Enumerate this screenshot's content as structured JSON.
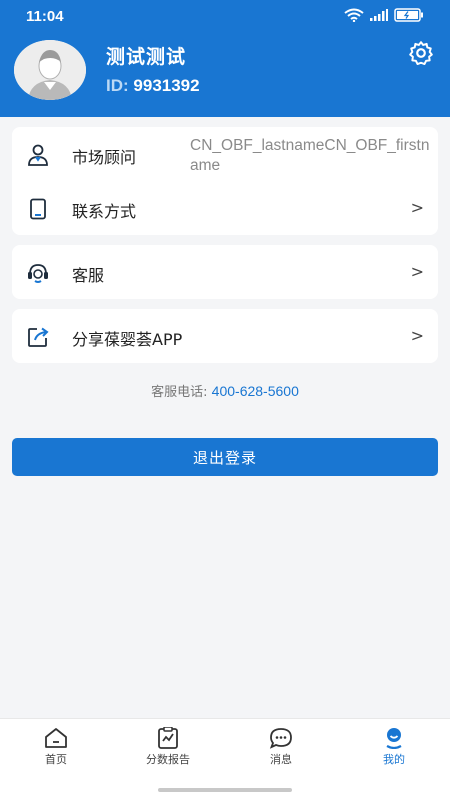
{
  "status": {
    "time": "11:04"
  },
  "profile": {
    "name": "测试测试",
    "id_label": "ID:",
    "id_value": "9931392"
  },
  "menu": {
    "advisor": {
      "label": "市场顾问",
      "value": "CN_OBF_lastnameCN_OBF_firstname"
    },
    "contact": {
      "label": "联系方式",
      "chevron": ">"
    },
    "service": {
      "label": "客服",
      "chevron": ">"
    },
    "share": {
      "label": "分享葆婴荟APP",
      "chevron": ">"
    }
  },
  "hotline": {
    "label": "客服电话:",
    "number": "400-628-5600"
  },
  "logout": {
    "label": "退出登录"
  },
  "tabs": [
    {
      "label": "首页",
      "icon": "home-icon"
    },
    {
      "label": "分数报告",
      "icon": "report-icon"
    },
    {
      "label": "消息",
      "icon": "message-icon"
    },
    {
      "label": "我的",
      "icon": "profile-icon",
      "active": true
    }
  ],
  "colors": {
    "primary": "#1976d2",
    "background": "#f4f5f7",
    "card": "#ffffff"
  }
}
